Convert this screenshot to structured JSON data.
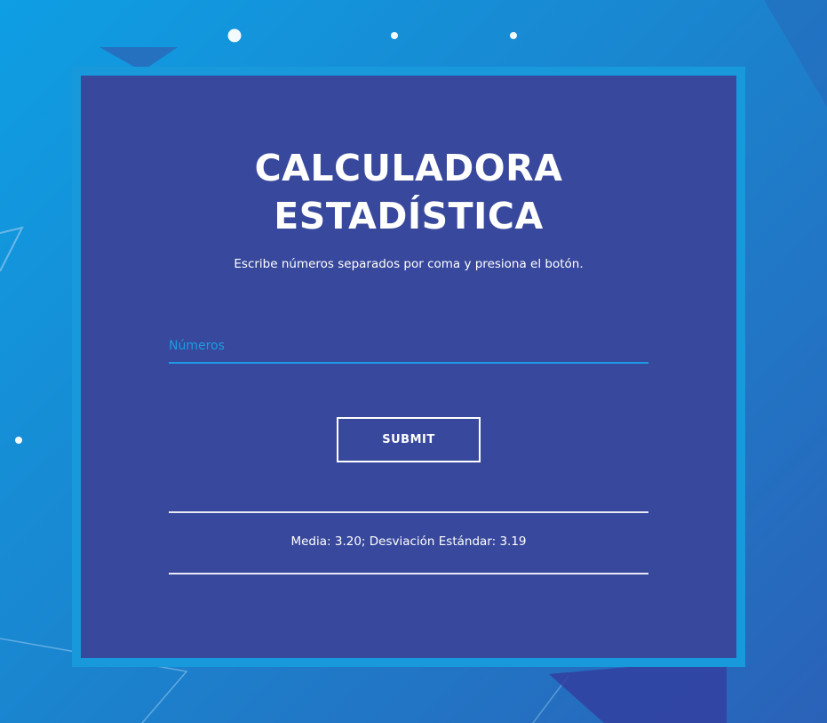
{
  "calculator": {
    "title_line1": "CALCULADORA",
    "title_line2": "ESTADÍSTICA",
    "instructions": "Escribe números separados por coma y presiona el botón.",
    "numbers_input": {
      "placeholder": "Números",
      "value": ""
    },
    "submit_label": "SUBMIT",
    "result": "Media: 3.20; Desviación Estándar: 3.19"
  },
  "colors": {
    "card_background": "#38489c",
    "card_border": "#1799dc",
    "accent": "#1b9ce3",
    "text": "#ffffff"
  }
}
